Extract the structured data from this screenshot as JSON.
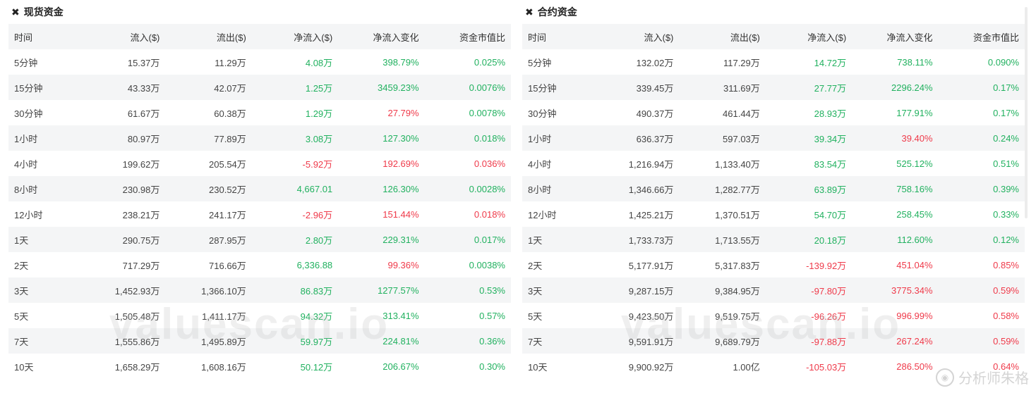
{
  "spot": {
    "title": "现货资金",
    "columns": [
      "时间",
      "流入($)",
      "流出($)",
      "净流入($)",
      "净流入变化",
      "资金市值比"
    ],
    "rows": [
      {
        "time": "5分钟",
        "inflow": "15.37万",
        "outflow": "11.29万",
        "net": "4.08万",
        "change": "398.79%",
        "ratio": "0.025%",
        "net_dir": "pos",
        "chg_dir": "pos",
        "ratio_dir": "pos"
      },
      {
        "time": "15分钟",
        "inflow": "43.33万",
        "outflow": "42.07万",
        "net": "1.25万",
        "change": "3459.23%",
        "ratio": "0.0076%",
        "net_dir": "pos",
        "chg_dir": "pos",
        "ratio_dir": "pos"
      },
      {
        "time": "30分钟",
        "inflow": "61.67万",
        "outflow": "60.38万",
        "net": "1.29万",
        "change": "27.79%",
        "ratio": "0.0078%",
        "net_dir": "pos",
        "chg_dir": "neg",
        "ratio_dir": "pos"
      },
      {
        "time": "1小时",
        "inflow": "80.97万",
        "outflow": "77.89万",
        "net": "3.08万",
        "change": "127.30%",
        "ratio": "0.018%",
        "net_dir": "pos",
        "chg_dir": "pos",
        "ratio_dir": "pos"
      },
      {
        "time": "4小时",
        "inflow": "199.62万",
        "outflow": "205.54万",
        "net": "-5.92万",
        "change": "192.69%",
        "ratio": "0.036%",
        "net_dir": "neg",
        "chg_dir": "neg",
        "ratio_dir": "neg"
      },
      {
        "time": "8小时",
        "inflow": "230.98万",
        "outflow": "230.52万",
        "net": "4,667.01",
        "change": "126.30%",
        "ratio": "0.0028%",
        "net_dir": "pos",
        "chg_dir": "pos",
        "ratio_dir": "pos"
      },
      {
        "time": "12小时",
        "inflow": "238.21万",
        "outflow": "241.17万",
        "net": "-2.96万",
        "change": "151.44%",
        "ratio": "0.018%",
        "net_dir": "neg",
        "chg_dir": "neg",
        "ratio_dir": "neg"
      },
      {
        "time": "1天",
        "inflow": "290.75万",
        "outflow": "287.95万",
        "net": "2.80万",
        "change": "229.31%",
        "ratio": "0.017%",
        "net_dir": "pos",
        "chg_dir": "pos",
        "ratio_dir": "pos"
      },
      {
        "time": "2天",
        "inflow": "717.29万",
        "outflow": "716.66万",
        "net": "6,336.88",
        "change": "99.36%",
        "ratio": "0.0038%",
        "net_dir": "pos",
        "chg_dir": "neg",
        "ratio_dir": "pos"
      },
      {
        "time": "3天",
        "inflow": "1,452.93万",
        "outflow": "1,366.10万",
        "net": "86.83万",
        "change": "1277.57%",
        "ratio": "0.53%",
        "net_dir": "pos",
        "chg_dir": "pos",
        "ratio_dir": "pos"
      },
      {
        "time": "5天",
        "inflow": "1,505.48万",
        "outflow": "1,411.17万",
        "net": "94.32万",
        "change": "313.41%",
        "ratio": "0.57%",
        "net_dir": "pos",
        "chg_dir": "pos",
        "ratio_dir": "pos"
      },
      {
        "time": "7天",
        "inflow": "1,555.86万",
        "outflow": "1,495.89万",
        "net": "59.97万",
        "change": "224.81%",
        "ratio": "0.36%",
        "net_dir": "pos",
        "chg_dir": "pos",
        "ratio_dir": "pos"
      },
      {
        "time": "10天",
        "inflow": "1,658.29万",
        "outflow": "1,608.16万",
        "net": "50.12万",
        "change": "206.67%",
        "ratio": "0.30%",
        "net_dir": "pos",
        "chg_dir": "pos",
        "ratio_dir": "pos"
      }
    ]
  },
  "futures": {
    "title": "合约资金",
    "columns": [
      "时间",
      "流入($)",
      "流出($)",
      "净流入($)",
      "净流入变化",
      "资金市值比"
    ],
    "rows": [
      {
        "time": "5分钟",
        "inflow": "132.02万",
        "outflow": "117.29万",
        "net": "14.72万",
        "change": "738.11%",
        "ratio": "0.090%",
        "net_dir": "pos",
        "chg_dir": "pos",
        "ratio_dir": "pos"
      },
      {
        "time": "15分钟",
        "inflow": "339.45万",
        "outflow": "311.69万",
        "net": "27.77万",
        "change": "2296.24%",
        "ratio": "0.17%",
        "net_dir": "pos",
        "chg_dir": "pos",
        "ratio_dir": "pos"
      },
      {
        "time": "30分钟",
        "inflow": "490.37万",
        "outflow": "461.44万",
        "net": "28.93万",
        "change": "177.91%",
        "ratio": "0.17%",
        "net_dir": "pos",
        "chg_dir": "pos",
        "ratio_dir": "pos"
      },
      {
        "time": "1小时",
        "inflow": "636.37万",
        "outflow": "597.03万",
        "net": "39.34万",
        "change": "39.40%",
        "ratio": "0.24%",
        "net_dir": "pos",
        "chg_dir": "neg",
        "ratio_dir": "pos"
      },
      {
        "time": "4小时",
        "inflow": "1,216.94万",
        "outflow": "1,133.40万",
        "net": "83.54万",
        "change": "525.12%",
        "ratio": "0.51%",
        "net_dir": "pos",
        "chg_dir": "pos",
        "ratio_dir": "pos"
      },
      {
        "time": "8小时",
        "inflow": "1,346.66万",
        "outflow": "1,282.77万",
        "net": "63.89万",
        "change": "758.16%",
        "ratio": "0.39%",
        "net_dir": "pos",
        "chg_dir": "pos",
        "ratio_dir": "pos"
      },
      {
        "time": "12小时",
        "inflow": "1,425.21万",
        "outflow": "1,370.51万",
        "net": "54.70万",
        "change": "258.45%",
        "ratio": "0.33%",
        "net_dir": "pos",
        "chg_dir": "pos",
        "ratio_dir": "pos"
      },
      {
        "time": "1天",
        "inflow": "1,733.73万",
        "outflow": "1,713.55万",
        "net": "20.18万",
        "change": "112.60%",
        "ratio": "0.12%",
        "net_dir": "pos",
        "chg_dir": "pos",
        "ratio_dir": "pos"
      },
      {
        "time": "2天",
        "inflow": "5,177.91万",
        "outflow": "5,317.83万",
        "net": "-139.92万",
        "change": "451.04%",
        "ratio": "0.85%",
        "net_dir": "neg",
        "chg_dir": "neg",
        "ratio_dir": "neg"
      },
      {
        "time": "3天",
        "inflow": "9,287.15万",
        "outflow": "9,384.95万",
        "net": "-97.80万",
        "change": "3775.34%",
        "ratio": "0.59%",
        "net_dir": "neg",
        "chg_dir": "neg",
        "ratio_dir": "neg"
      },
      {
        "time": "5天",
        "inflow": "9,423.50万",
        "outflow": "9,519.75万",
        "net": "-96.26万",
        "change": "996.99%",
        "ratio": "0.58%",
        "net_dir": "neg",
        "chg_dir": "neg",
        "ratio_dir": "neg"
      },
      {
        "time": "7天",
        "inflow": "9,591.91万",
        "outflow": "9,689.79万",
        "net": "-97.88万",
        "change": "267.24%",
        "ratio": "0.59%",
        "net_dir": "neg",
        "chg_dir": "neg",
        "ratio_dir": "neg"
      },
      {
        "time": "10天",
        "inflow": "9,900.92万",
        "outflow": "1.00亿",
        "net": "-105.03万",
        "change": "286.50%",
        "ratio": "0.64%",
        "net_dir": "neg",
        "chg_dir": "neg",
        "ratio_dir": "neg"
      }
    ]
  },
  "watermark": "valuescan.io",
  "brand": {
    "icon": "weibo-icon",
    "text": "分析师朱格"
  },
  "colors": {
    "positive": "#21b15f",
    "negative": "#ef3a4a",
    "stripe": "#f4f5f6"
  }
}
